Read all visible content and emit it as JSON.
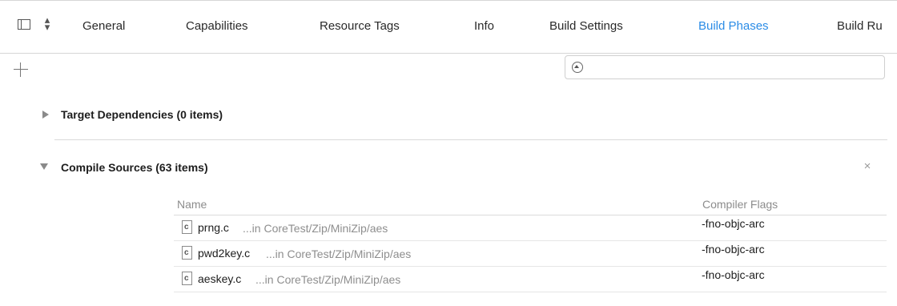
{
  "tabs": [
    {
      "label": "General"
    },
    {
      "label": "Capabilities"
    },
    {
      "label": "Resource Tags"
    },
    {
      "label": "Info"
    },
    {
      "label": "Build Settings"
    },
    {
      "label": "Build Phases",
      "active": true
    },
    {
      "label": "Build Ru"
    }
  ],
  "toolbar": {
    "add_icon": "plus-icon",
    "search_value": "",
    "search_icon": "filter-icon"
  },
  "sections": {
    "target_dependencies": {
      "title": "Target Dependencies (0 items)",
      "expanded": false
    },
    "compile_sources": {
      "title": "Compile Sources (63 items)",
      "expanded": true
    }
  },
  "table": {
    "headers": {
      "name": "Name",
      "flags": "Compiler Flags"
    },
    "rows": [
      {
        "file": "prng.c",
        "path": "...in CoreTest/Zip/MiniZip/aes",
        "flags": "-fno-objc-arc"
      },
      {
        "file": "pwd2key.c",
        "path": "...in CoreTest/Zip/MiniZip/aes",
        "flags": "-fno-objc-arc"
      },
      {
        "file": "aeskey.c",
        "path": "...in CoreTest/Zip/MiniZip/aes",
        "flags": "-fno-objc-arc"
      }
    ]
  },
  "colors": {
    "active_tab": "#2b8ce6",
    "divider": "#dadada"
  }
}
